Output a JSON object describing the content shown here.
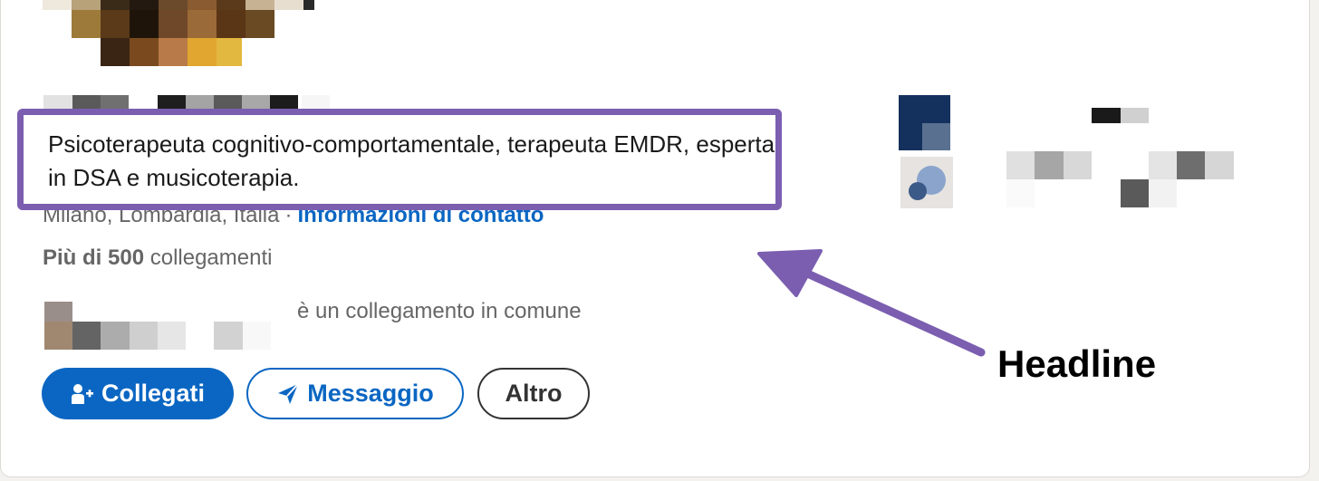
{
  "profile": {
    "headline": "Psicoterapeuta cognitivo-comportamentale, terapeuta EMDR, esperta in DSA e musicoterapia.",
    "location": "Milano, Lombardia, Italia",
    "location_separator": "·",
    "contact_info_link": "Informazioni di contatto",
    "connections_count": "Più di 500",
    "connections_label": "collegamenti",
    "mutual_connection_text": "è un collegamento in comune"
  },
  "actions": {
    "connect_label": "Collegati",
    "message_label": "Messaggio",
    "more_label": "Altro"
  },
  "annotation": {
    "label": "Headline"
  },
  "colors": {
    "linkedin_blue": "#0a66c2",
    "annotation_purple": "#7b5eb0",
    "muted_text": "#666666"
  },
  "icons": {
    "connect": "add-person-icon",
    "message": "send-paper-plane-icon"
  }
}
